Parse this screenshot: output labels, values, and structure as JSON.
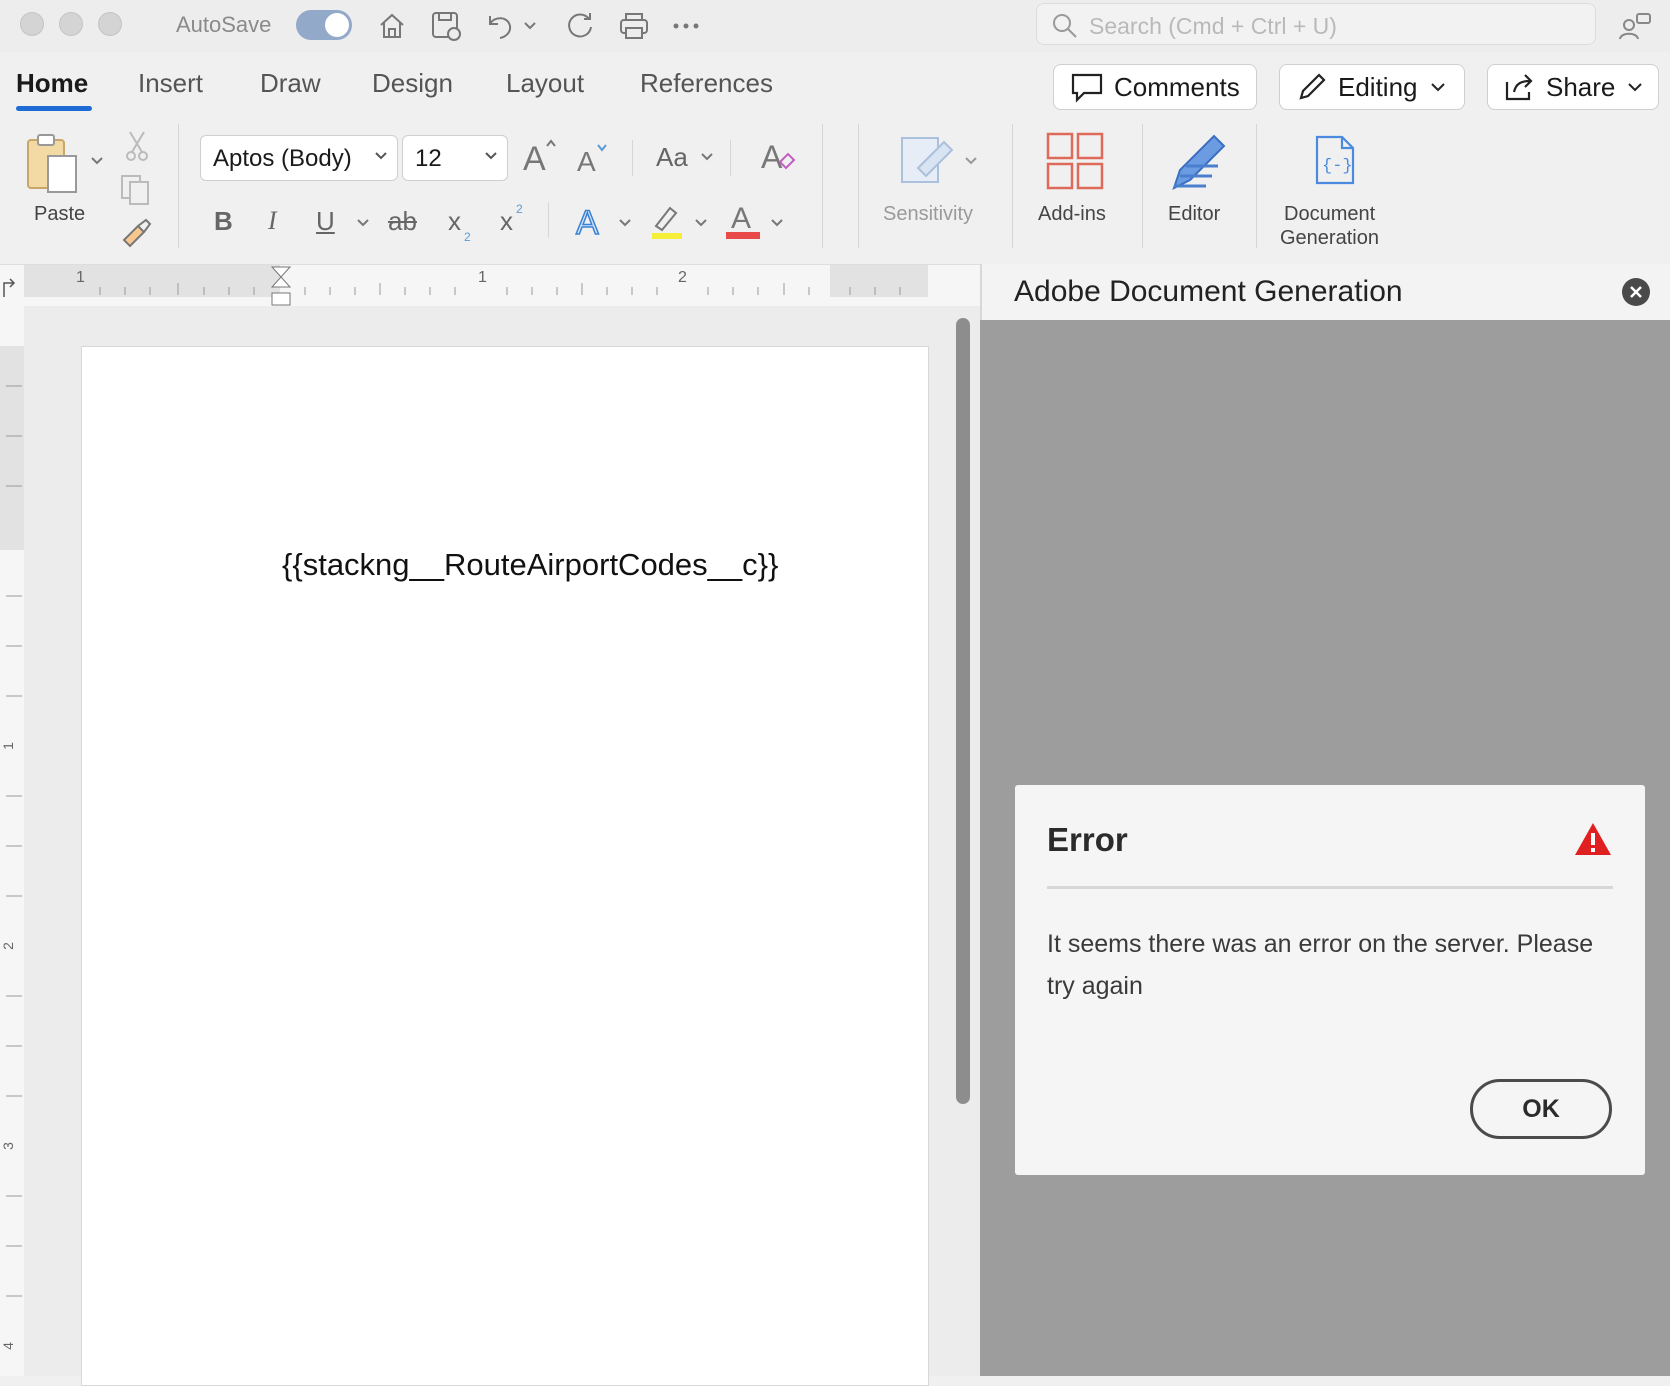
{
  "titlebar": {
    "autosave_label": "AutoSave",
    "search_placeholder": "Search (Cmd + Ctrl + U)"
  },
  "tabs": [
    "Home",
    "Insert",
    "Draw",
    "Design",
    "Layout",
    "References"
  ],
  "header_buttons": {
    "comments": "Comments",
    "editing": "Editing",
    "share": "Share"
  },
  "ribbon": {
    "paste": "Paste",
    "font_name": "Aptos (Body)",
    "font_size": "12",
    "change_case": "Aa",
    "sensitivity": "Sensitivity",
    "addins": "Add-ins",
    "editor": "Editor",
    "docgen_line1": "Document",
    "docgen_line2": "Generation",
    "bold": "B",
    "italic": "I",
    "underline": "U",
    "strike": "ab",
    "subscript": "x",
    "superscript": "x"
  },
  "ruler": {
    "h_marks": [
      "1",
      "1",
      "2"
    ],
    "v_marks": [
      "1",
      "2",
      "3",
      "4"
    ]
  },
  "document": {
    "text": "{{stackng__RouteAirportCodes__c}}"
  },
  "panel": {
    "title": "Adobe Document Generation",
    "dialog": {
      "title": "Error",
      "message": "It seems there was an error on the server. Please try again",
      "ok": "OK"
    }
  },
  "colors": {
    "accent": "#1f6bd6",
    "error_red": "#e02020",
    "highlight_yellow": "#f5ef3a",
    "font_color_red": "#e84a4a"
  }
}
